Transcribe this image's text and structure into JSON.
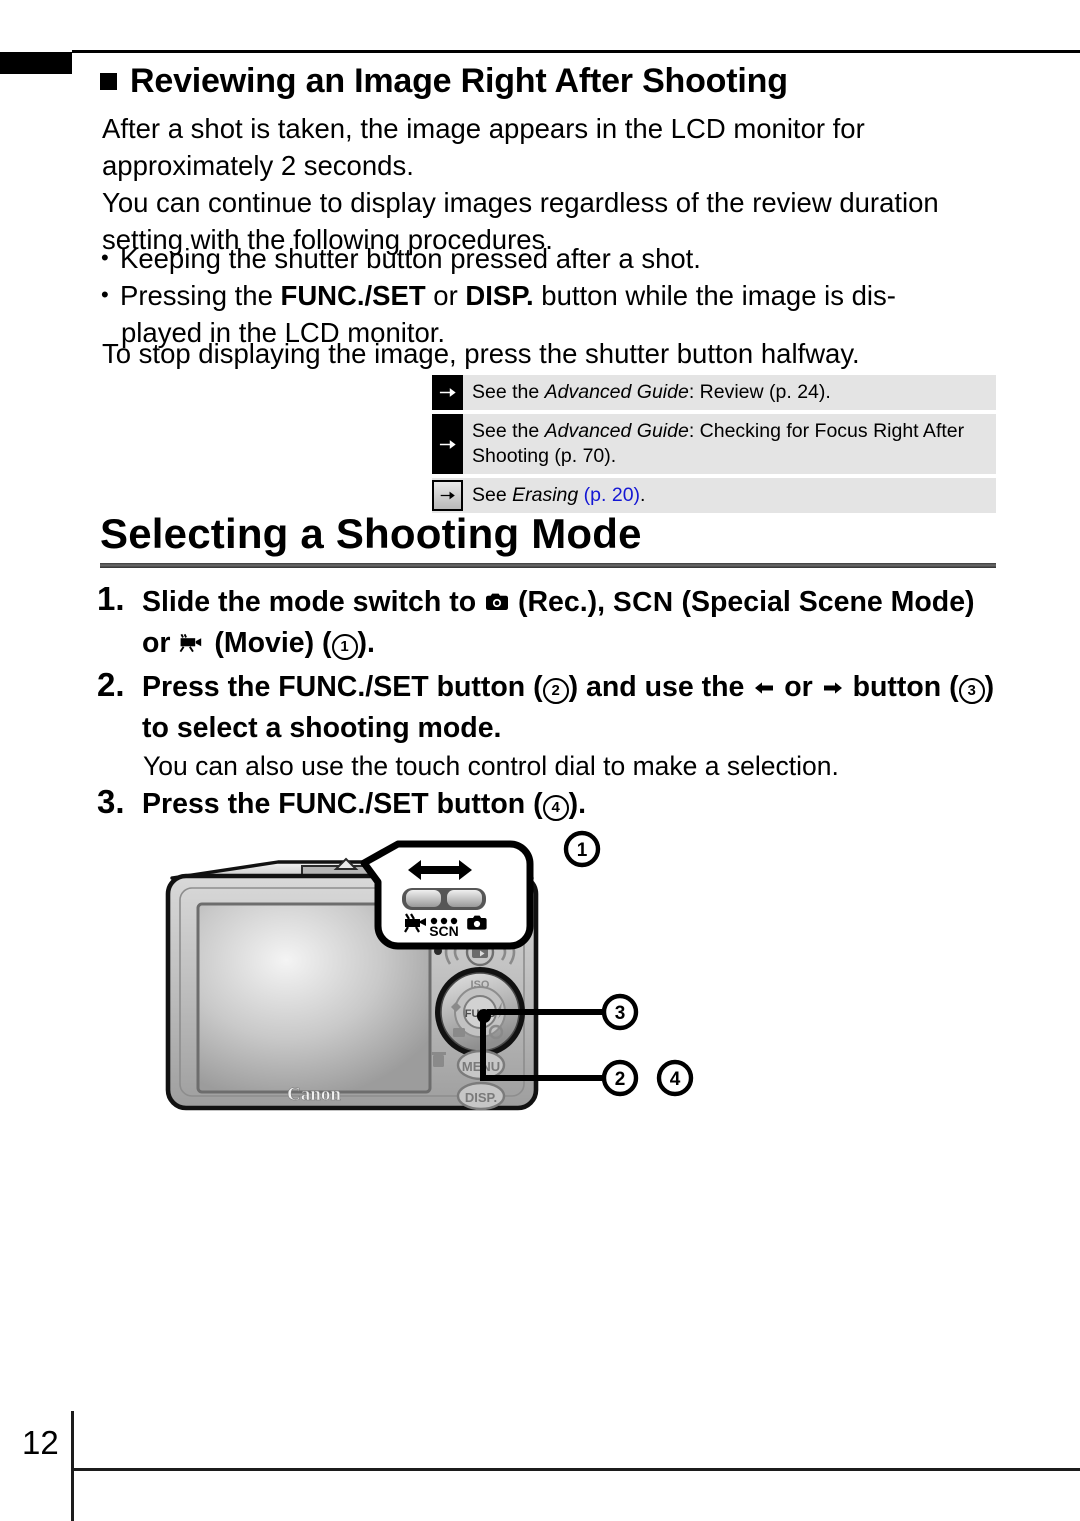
{
  "header": {
    "section_title": "Reviewing an Image Right After Shooting",
    "bullet_square": "filled-square-marker"
  },
  "body": {
    "paragraph1": "After a shot is taken, the image appears in the LCD monitor for approximately 2 seconds.",
    "paragraph2": "You can continue to display images regardless of the review duration setting with the following procedures.",
    "bullet1": "Keeping the shutter button pressed after a shot.",
    "bullet2_pre": "Pressing the ",
    "bullet2_bold1": "FUNC./SET",
    "bullet2_mid": " or ",
    "bullet2_bold2": "DISP.",
    "bullet2_post": " button while the image is dis-",
    "bullet2_line2": "played in the LCD monitor.",
    "paragraph3": "To stop displaying the image, press the shutter button halfway."
  },
  "references": [
    {
      "icon": "arrow-right-icon",
      "icon_style": "dark",
      "pre": "See the ",
      "italic": "Advanced Guide",
      "post": ": Review (p. 24)."
    },
    {
      "icon": "arrow-right-icon",
      "icon_style": "dark",
      "pre": "See the ",
      "italic": "Advanced Guide",
      "post": ": Checking for Focus Right After Shooting (p. 70)."
    },
    {
      "icon": "arrow-right-icon",
      "icon_style": "light",
      "pre": "See ",
      "italic": "Erasing",
      "post": " ",
      "link": "(p. 20)",
      "tail": "."
    }
  ],
  "section": {
    "heading": "Selecting a Shooting Mode"
  },
  "steps": {
    "step1": {
      "number": "1.",
      "part1": "Slide the mode switch to ",
      "icon1": "camera-icon",
      "part2": " (Rec.), ",
      "scn": "SCN",
      "part3": "  (Special Scene Mode) or ",
      "icon2": "movie-camera-icon",
      "part4": " (Movie) (",
      "circle": "1",
      "part5": ")."
    },
    "step2": {
      "number": "2.",
      "part1": "Press the FUNC./SET button (",
      "circle_a": "2",
      "part2": ") and use the ",
      "icon_left": "arrow-left-icon",
      "part3": " or ",
      "icon_right": "arrow-right-icon",
      "part4": " button (",
      "circle_b": "3",
      "part5": ") to select a shooting mode."
    },
    "note": "You can also use the touch control dial to make a selection.",
    "step3": {
      "number": "3.",
      "part1": "Press the FUNC./SET button (",
      "circle": "4",
      "part2": ")."
    }
  },
  "illustration": {
    "name": "camera-rear-diagram",
    "brand": "Canon",
    "callout_bubble": {
      "name": "mode-switch-callout",
      "arrow": "double-headed-horizontal-arrow",
      "switch": "mode-slider-switch",
      "labels": [
        "movie-camera-icon",
        "scn-dots",
        "SCN",
        "camera-icon"
      ]
    },
    "buttons": {
      "print_share": "print-share-button",
      "playback": "playback-button",
      "menu": "MENU",
      "disp": "DISP.",
      "func_set": "FUNC.",
      "iso": "ISO",
      "flash": "flash-icon",
      "macro": "macro-icon",
      "drive": "drive-mode-icon",
      "timer": "self-timer-icon",
      "trash": "trash-icon"
    },
    "callout_numbers": [
      "1",
      "3",
      "2",
      "4"
    ]
  },
  "footer": {
    "page_number": "12"
  },
  "colors": {
    "ref_box_bg": "#e4e4e4",
    "link_blue": "#1417d4",
    "rule_dark": "#3d3d3d"
  }
}
